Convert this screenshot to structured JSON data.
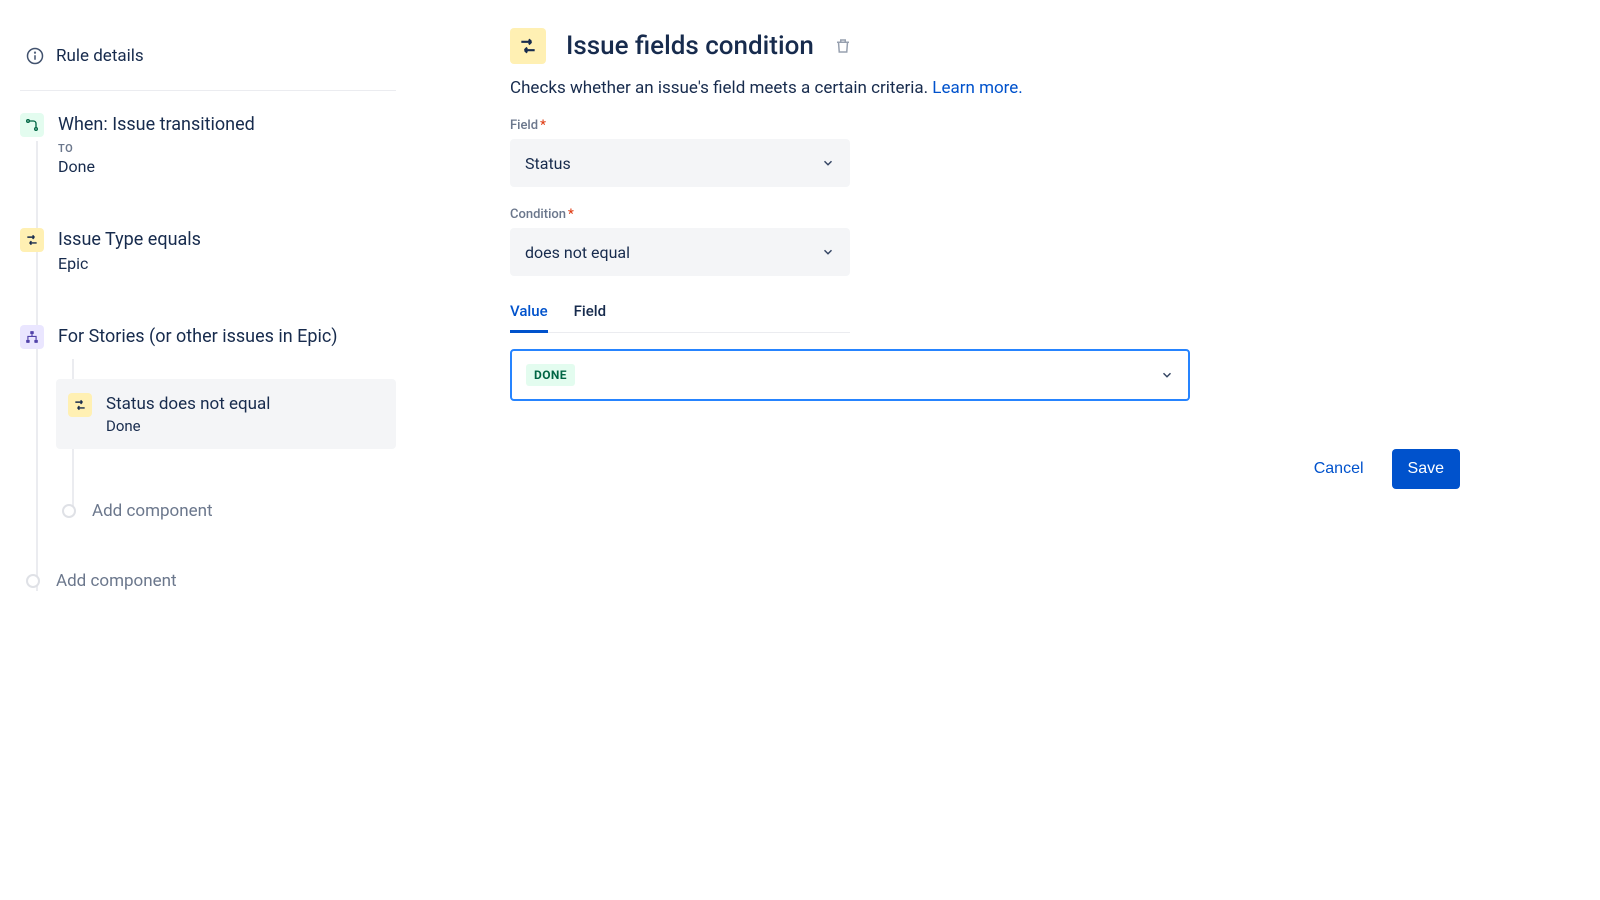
{
  "sidebar": {
    "rule_details": "Rule details",
    "nodes": [
      {
        "title": "When: Issue transitioned",
        "sub_label": "TO",
        "sub": "Done"
      },
      {
        "title": "Issue Type equals",
        "sub": "Epic"
      },
      {
        "title": "For Stories (or other issues in Epic)"
      }
    ],
    "nested_selected": {
      "title": "Status does not equal",
      "sub": "Done"
    },
    "add_component_nested": "Add component",
    "add_component": "Add component"
  },
  "main": {
    "title": "Issue fields condition",
    "description": "Checks whether an issue's field meets a certain criteria. ",
    "learn_more": "Learn more.",
    "field_label": "Field",
    "field_value": "Status",
    "condition_label": "Condition",
    "condition_value": "does not equal",
    "tabs": {
      "value": "Value",
      "field": "Field"
    },
    "value_chip": "DONE",
    "cancel": "Cancel",
    "save": "Save"
  }
}
